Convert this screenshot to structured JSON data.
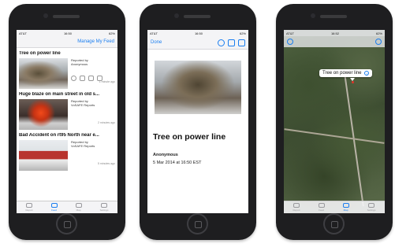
{
  "screen1": {
    "status": {
      "carrier": "AT&T",
      "time": "16:50",
      "battery": "62%"
    },
    "nav_link": "Manage My Feed",
    "items": [
      {
        "title": "Tree on power line",
        "reported": "Reported by",
        "by": "Anonymous",
        "time": "1 minute ago",
        "thumb": "tree"
      },
      {
        "title": "Huge blaze on main street in old s...",
        "reported": "Reported by",
        "by": "VoSAFE Reports",
        "time": "2 minutes ago",
        "thumb": "fire"
      },
      {
        "title": "Bad Accident on rt95 North near e...",
        "reported": "Reported by",
        "by": "VoSAFE Reports",
        "time": "5 minutes ago",
        "thumb": "truck"
      }
    ],
    "tabs": [
      "Report",
      "Feed",
      "Map",
      "Settings"
    ]
  },
  "screen2": {
    "status": {
      "carrier": "AT&T",
      "time": "16:50",
      "battery": "62%"
    },
    "done_label": "Done",
    "title": "Tree on power line",
    "author": "Anonymous",
    "date": "5 Mar 2014 at 16:50 EST"
  },
  "screen3": {
    "status": {
      "carrier": "AT&T",
      "time": "16:52",
      "battery": "62%"
    },
    "callout": "Tree on power line",
    "tabs": [
      "Report",
      "Feed",
      "Map",
      "Settings"
    ]
  },
  "colors": {
    "accent": "#1a7ef0",
    "phone_body": "#1e1e20",
    "pin": "#e0352a"
  }
}
